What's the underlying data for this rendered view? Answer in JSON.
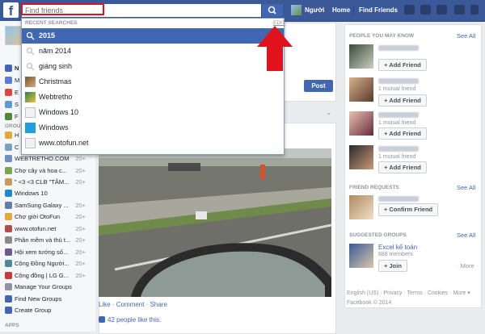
{
  "topbar": {
    "search_placeholder": "Find friends",
    "nav": [
      "Người",
      "Home",
      "Find Friends"
    ]
  },
  "dropdown": {
    "heading": "RECENT SEARCHES",
    "edit": "EDIT",
    "items": [
      "2015",
      "năm 2014",
      "giáng sinh",
      "Christmas",
      "Webtretho",
      "Windows 10",
      "Windows",
      "www.otofun.net"
    ]
  },
  "left": {
    "groups_heading": "GROU",
    "apps_heading": "APPS",
    "items": [
      {
        "label": "N",
        "count": ""
      },
      {
        "label": "M",
        "count": ""
      },
      {
        "label": "E",
        "count": ""
      },
      {
        "label": "S",
        "count": ""
      },
      {
        "label": "F",
        "count": ""
      },
      {
        "label": "H",
        "count": ""
      },
      {
        "label": "C",
        "count": ""
      },
      {
        "label": "WEBTRETHO.COM",
        "count": "20+"
      },
      {
        "label": "Chợ cây và hoa c...",
        "count": "20+"
      },
      {
        "label": "\" <3 <3 CLB \"TÂM...",
        "count": "20+"
      },
      {
        "label": "Windows 10",
        "count": ""
      },
      {
        "label": "SamSung Galaxy ...",
        "count": "20+"
      },
      {
        "label": "Chợ giời OtoFun",
        "count": "20+"
      },
      {
        "label": "www.otofun.net",
        "count": "20+"
      },
      {
        "label": "Phần mềm và thủ t...",
        "count": "20+"
      },
      {
        "label": "Hội xem tướng số...",
        "count": "20+"
      },
      {
        "label": "Cộng Đồng Người...",
        "count": "20+"
      },
      {
        "label": "Cộng đồng | LG G...",
        "count": "20+"
      },
      {
        "label": "Manage Your Groups",
        "count": ""
      },
      {
        "label": "Find New Groups",
        "count": ""
      },
      {
        "label": "Create Group",
        "count": ""
      }
    ]
  },
  "center": {
    "post_button": "Post",
    "actions": "Like · Comment · Share",
    "likes": "42 people like this."
  },
  "right": {
    "pymk_heading": "PEOPLE YOU MAY KNOW",
    "see_all": "See All",
    "mutual": "1 mutual friend",
    "add_friend": "Add Friend",
    "requests_heading": "FRIEND REQUESTS",
    "confirm": "Confirm Friend",
    "suggested_heading": "SUGGESTED GROUPS",
    "group_name": "Excel kế toán",
    "group_members": "888 members",
    "join": "+ Join",
    "more": "More"
  },
  "footer": {
    "line1": "English (US) · Privacy · Terms · Cookies · More ▾",
    "line2": "Facebook © 2014"
  },
  "colors": {
    "brand": "#3b5998",
    "highlight": "#e0121b",
    "accent": "#4267b2"
  }
}
